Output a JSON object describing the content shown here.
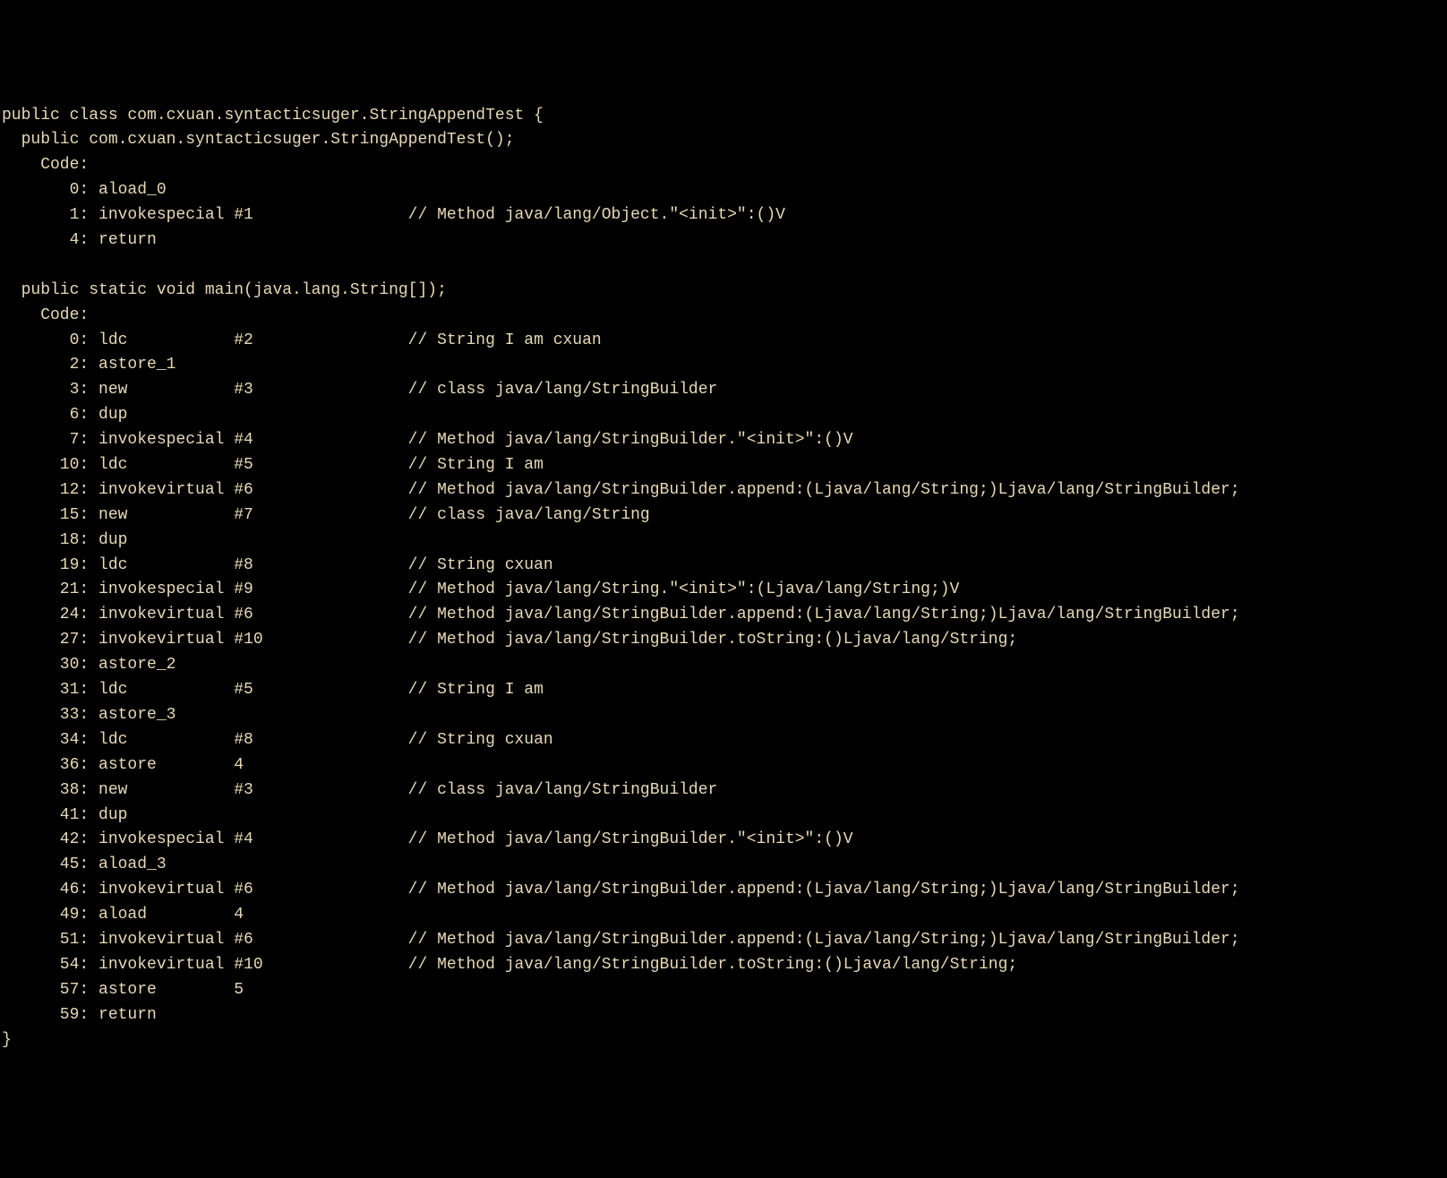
{
  "class_declaration": "public class com.cxuan.syntacticsuger.StringAppendTest {",
  "constructor": {
    "signature": "  public com.cxuan.syntacticsuger.StringAppendTest();",
    "code_label": "    Code:",
    "instructions": [
      {
        "offset": "       0:",
        "op": "aload_0",
        "arg": "",
        "comment": ""
      },
      {
        "offset": "       1:",
        "op": "invokespecial",
        "arg": "#1",
        "comment": "// Method java/lang/Object.\"<init>\":()V"
      },
      {
        "offset": "       4:",
        "op": "return",
        "arg": "",
        "comment": ""
      }
    ]
  },
  "main_method": {
    "signature": "  public static void main(java.lang.String[]);",
    "code_label": "    Code:",
    "instructions": [
      {
        "offset": "       0:",
        "op": "ldc",
        "arg": "#2",
        "comment": "// String I am cxuan"
      },
      {
        "offset": "       2:",
        "op": "astore_1",
        "arg": "",
        "comment": ""
      },
      {
        "offset": "       3:",
        "op": "new",
        "arg": "#3",
        "comment": "// class java/lang/StringBuilder"
      },
      {
        "offset": "       6:",
        "op": "dup",
        "arg": "",
        "comment": ""
      },
      {
        "offset": "       7:",
        "op": "invokespecial",
        "arg": "#4",
        "comment": "// Method java/lang/StringBuilder.\"<init>\":()V"
      },
      {
        "offset": "      10:",
        "op": "ldc",
        "arg": "#5",
        "comment": "// String I am"
      },
      {
        "offset": "      12:",
        "op": "invokevirtual",
        "arg": "#6",
        "comment": "// Method java/lang/StringBuilder.append:(Ljava/lang/String;)Ljava/lang/StringBuilder;"
      },
      {
        "offset": "      15:",
        "op": "new",
        "arg": "#7",
        "comment": "// class java/lang/String"
      },
      {
        "offset": "      18:",
        "op": "dup",
        "arg": "",
        "comment": ""
      },
      {
        "offset": "      19:",
        "op": "ldc",
        "arg": "#8",
        "comment": "// String cxuan"
      },
      {
        "offset": "      21:",
        "op": "invokespecial",
        "arg": "#9",
        "comment": "// Method java/lang/String.\"<init>\":(Ljava/lang/String;)V"
      },
      {
        "offset": "      24:",
        "op": "invokevirtual",
        "arg": "#6",
        "comment": "// Method java/lang/StringBuilder.append:(Ljava/lang/String;)Ljava/lang/StringBuilder;"
      },
      {
        "offset": "      27:",
        "op": "invokevirtual",
        "arg": "#10",
        "comment": "// Method java/lang/StringBuilder.toString:()Ljava/lang/String;"
      },
      {
        "offset": "      30:",
        "op": "astore_2",
        "arg": "",
        "comment": ""
      },
      {
        "offset": "      31:",
        "op": "ldc",
        "arg": "#5",
        "comment": "// String I am"
      },
      {
        "offset": "      33:",
        "op": "astore_3",
        "arg": "",
        "comment": ""
      },
      {
        "offset": "      34:",
        "op": "ldc",
        "arg": "#8",
        "comment": "// String cxuan"
      },
      {
        "offset": "      36:",
        "op": "astore",
        "arg": "4",
        "comment": ""
      },
      {
        "offset": "      38:",
        "op": "new",
        "arg": "#3",
        "comment": "// class java/lang/StringBuilder"
      },
      {
        "offset": "      41:",
        "op": "dup",
        "arg": "",
        "comment": ""
      },
      {
        "offset": "      42:",
        "op": "invokespecial",
        "arg": "#4",
        "comment": "// Method java/lang/StringBuilder.\"<init>\":()V"
      },
      {
        "offset": "      45:",
        "op": "aload_3",
        "arg": "",
        "comment": ""
      },
      {
        "offset": "      46:",
        "op": "invokevirtual",
        "arg": "#6",
        "comment": "// Method java/lang/StringBuilder.append:(Ljava/lang/String;)Ljava/lang/StringBuilder;"
      },
      {
        "offset": "      49:",
        "op": "aload",
        "arg": "4",
        "comment": ""
      },
      {
        "offset": "      51:",
        "op": "invokevirtual",
        "arg": "#6",
        "comment": "// Method java/lang/StringBuilder.append:(Ljava/lang/String;)Ljava/lang/StringBuilder;"
      },
      {
        "offset": "      54:",
        "op": "invokevirtual",
        "arg": "#10",
        "comment": "// Method java/lang/StringBuilder.toString:()Ljava/lang/String;"
      },
      {
        "offset": "      57:",
        "op": "astore",
        "arg": "5",
        "comment": ""
      },
      {
        "offset": "      59:",
        "op": "return",
        "arg": "",
        "comment": ""
      }
    ]
  },
  "closing_brace": "}"
}
